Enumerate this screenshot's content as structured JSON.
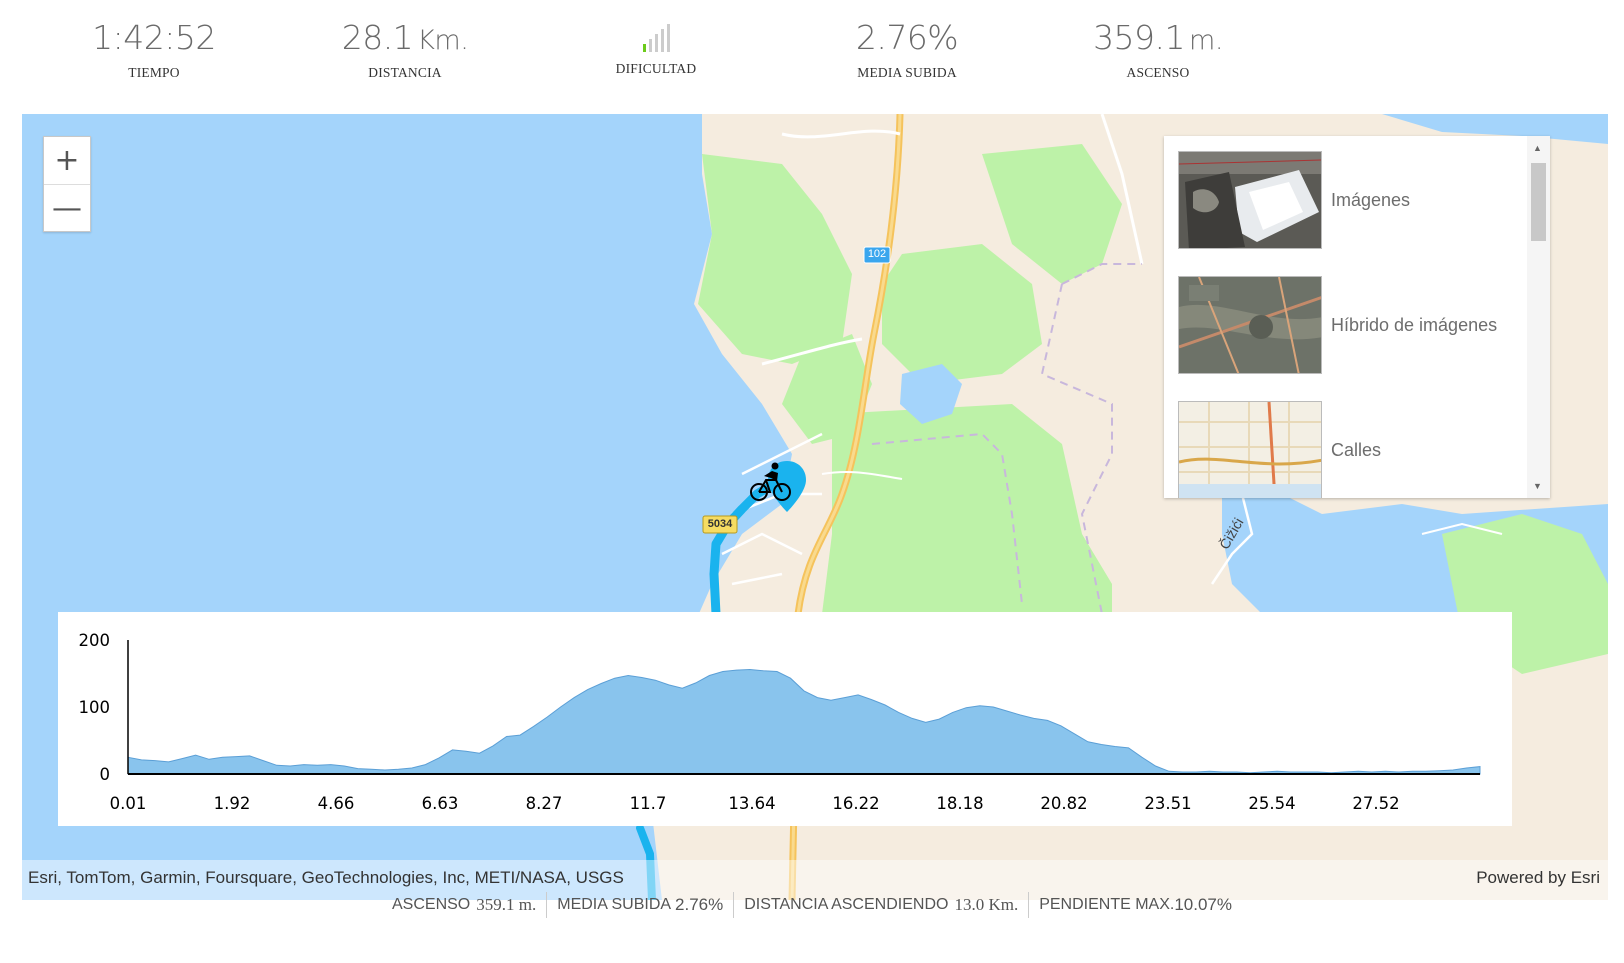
{
  "stats": {
    "tiempo": {
      "value": "1:42:52",
      "label": "TIEMPO"
    },
    "distancia": {
      "value": "28.1",
      "unit": "Km.",
      "label": "DISTANCIA"
    },
    "dificultad": {
      "label": "DIFICULTAD",
      "level_bars_on": 1,
      "level_bars_total": 5
    },
    "media_subida": {
      "value": "2.76%",
      "label": "MEDIA SUBIDA"
    },
    "ascenso": {
      "value": "359.1",
      "unit": "m.",
      "label": "ASCENSO"
    }
  },
  "map": {
    "road_label": "102",
    "road_label_2": "5034",
    "place_label": "Čižići",
    "zoom_in": "+",
    "zoom_out": "—",
    "basemaps": [
      {
        "label": "Imágenes",
        "icon": "satellite-thumbnail"
      },
      {
        "label": "Híbrido de imágenes",
        "icon": "hybrid-thumbnail"
      },
      {
        "label": "Calles",
        "icon": "streets-thumbnail"
      }
    ],
    "attribution": "Esri, TomTom, Garmin, Foursquare, GeoTechnologies, Inc, METI/NASA, USGS",
    "powered_by": "Powered by Esri",
    "marker_icon": "cyclist-icon",
    "colors": {
      "water": "#a4d4fb",
      "land": "#f5ecdf",
      "park": "#bdf2a8",
      "route": "#1ab3ee",
      "highway": "#f5c35c"
    }
  },
  "chart_data": {
    "type": "area",
    "yticks": [
      0,
      100,
      200
    ],
    "ylim": [
      0,
      200
    ],
    "xtick_labels": [
      "0.01",
      "1.92",
      "4.66",
      "6.63",
      "8.27",
      "11.7",
      "13.64",
      "16.22",
      "18.18",
      "20.82",
      "23.51",
      "25.54",
      "27.52"
    ],
    "x": [
      0,
      0.25,
      0.5,
      0.75,
      1,
      1.25,
      1.5,
      1.75,
      2,
      2.25,
      2.5,
      2.75,
      3,
      3.25,
      3.5,
      3.75,
      4,
      4.25,
      4.5,
      4.75,
      5,
      5.25,
      5.5,
      5.75,
      6,
      6.25,
      6.5,
      6.75,
      7,
      7.25,
      7.5,
      7.75,
      8,
      8.25,
      8.5,
      8.75,
      9,
      9.25,
      9.5,
      9.75,
      10,
      10.25,
      10.5,
      10.75,
      11,
      11.25,
      11.5,
      11.75,
      12,
      12.25,
      12.5,
      12.75,
      13,
      13.25,
      13.5,
      13.75,
      14,
      14.25,
      14.5,
      14.75,
      15,
      15.25,
      15.5,
      15.75,
      16,
      16.25,
      16.5,
      16.75,
      17,
      17.25,
      17.5,
      17.75,
      18,
      18.25,
      18.5,
      18.75,
      19,
      19.25,
      19.5,
      19.75,
      20,
      20.25,
      20.5,
      20.75,
      21,
      21.25,
      21.5,
      21.75,
      22,
      22.25,
      22.5,
      22.75,
      23,
      23.25,
      23.5,
      23.75,
      24,
      24.25,
      24.5,
      24.75,
      25
    ],
    "y": [
      25,
      21,
      20,
      18,
      23,
      28,
      22,
      25,
      26,
      27,
      20,
      13,
      12,
      14,
      13,
      14,
      12,
      8,
      7,
      6,
      7,
      9,
      14,
      24,
      36,
      34,
      31,
      42,
      56,
      58,
      71,
      85,
      100,
      114,
      126,
      135,
      143,
      147,
      144,
      140,
      133,
      128,
      136,
      147,
      153,
      155,
      156,
      154,
      153,
      143,
      124,
      114,
      110,
      114,
      118,
      111,
      103,
      92,
      83,
      77,
      82,
      92,
      99,
      102,
      100,
      94,
      88,
      83,
      80,
      72,
      60,
      48,
      44,
      41,
      39,
      25,
      12,
      4,
      3,
      3,
      4,
      3,
      3,
      2,
      3,
      4,
      3,
      3,
      3,
      2,
      3,
      4,
      3,
      4,
      3,
      4,
      4,
      5,
      6,
      9,
      11
    ],
    "fill_color": "#89c4ed",
    "line_color": "#5b9fd6"
  },
  "footer": {
    "ascenso": {
      "label": "ASCENSO",
      "value": "359.1 m."
    },
    "media": {
      "label": "MEDIA SUBIDA",
      "value": "2.76%"
    },
    "distancia": {
      "label": "DISTANCIA ASCENDIENDO",
      "value": "13.0 Km."
    },
    "pendiente": {
      "label": "PENDIENTE MAX.",
      "value": "10.07%"
    }
  }
}
